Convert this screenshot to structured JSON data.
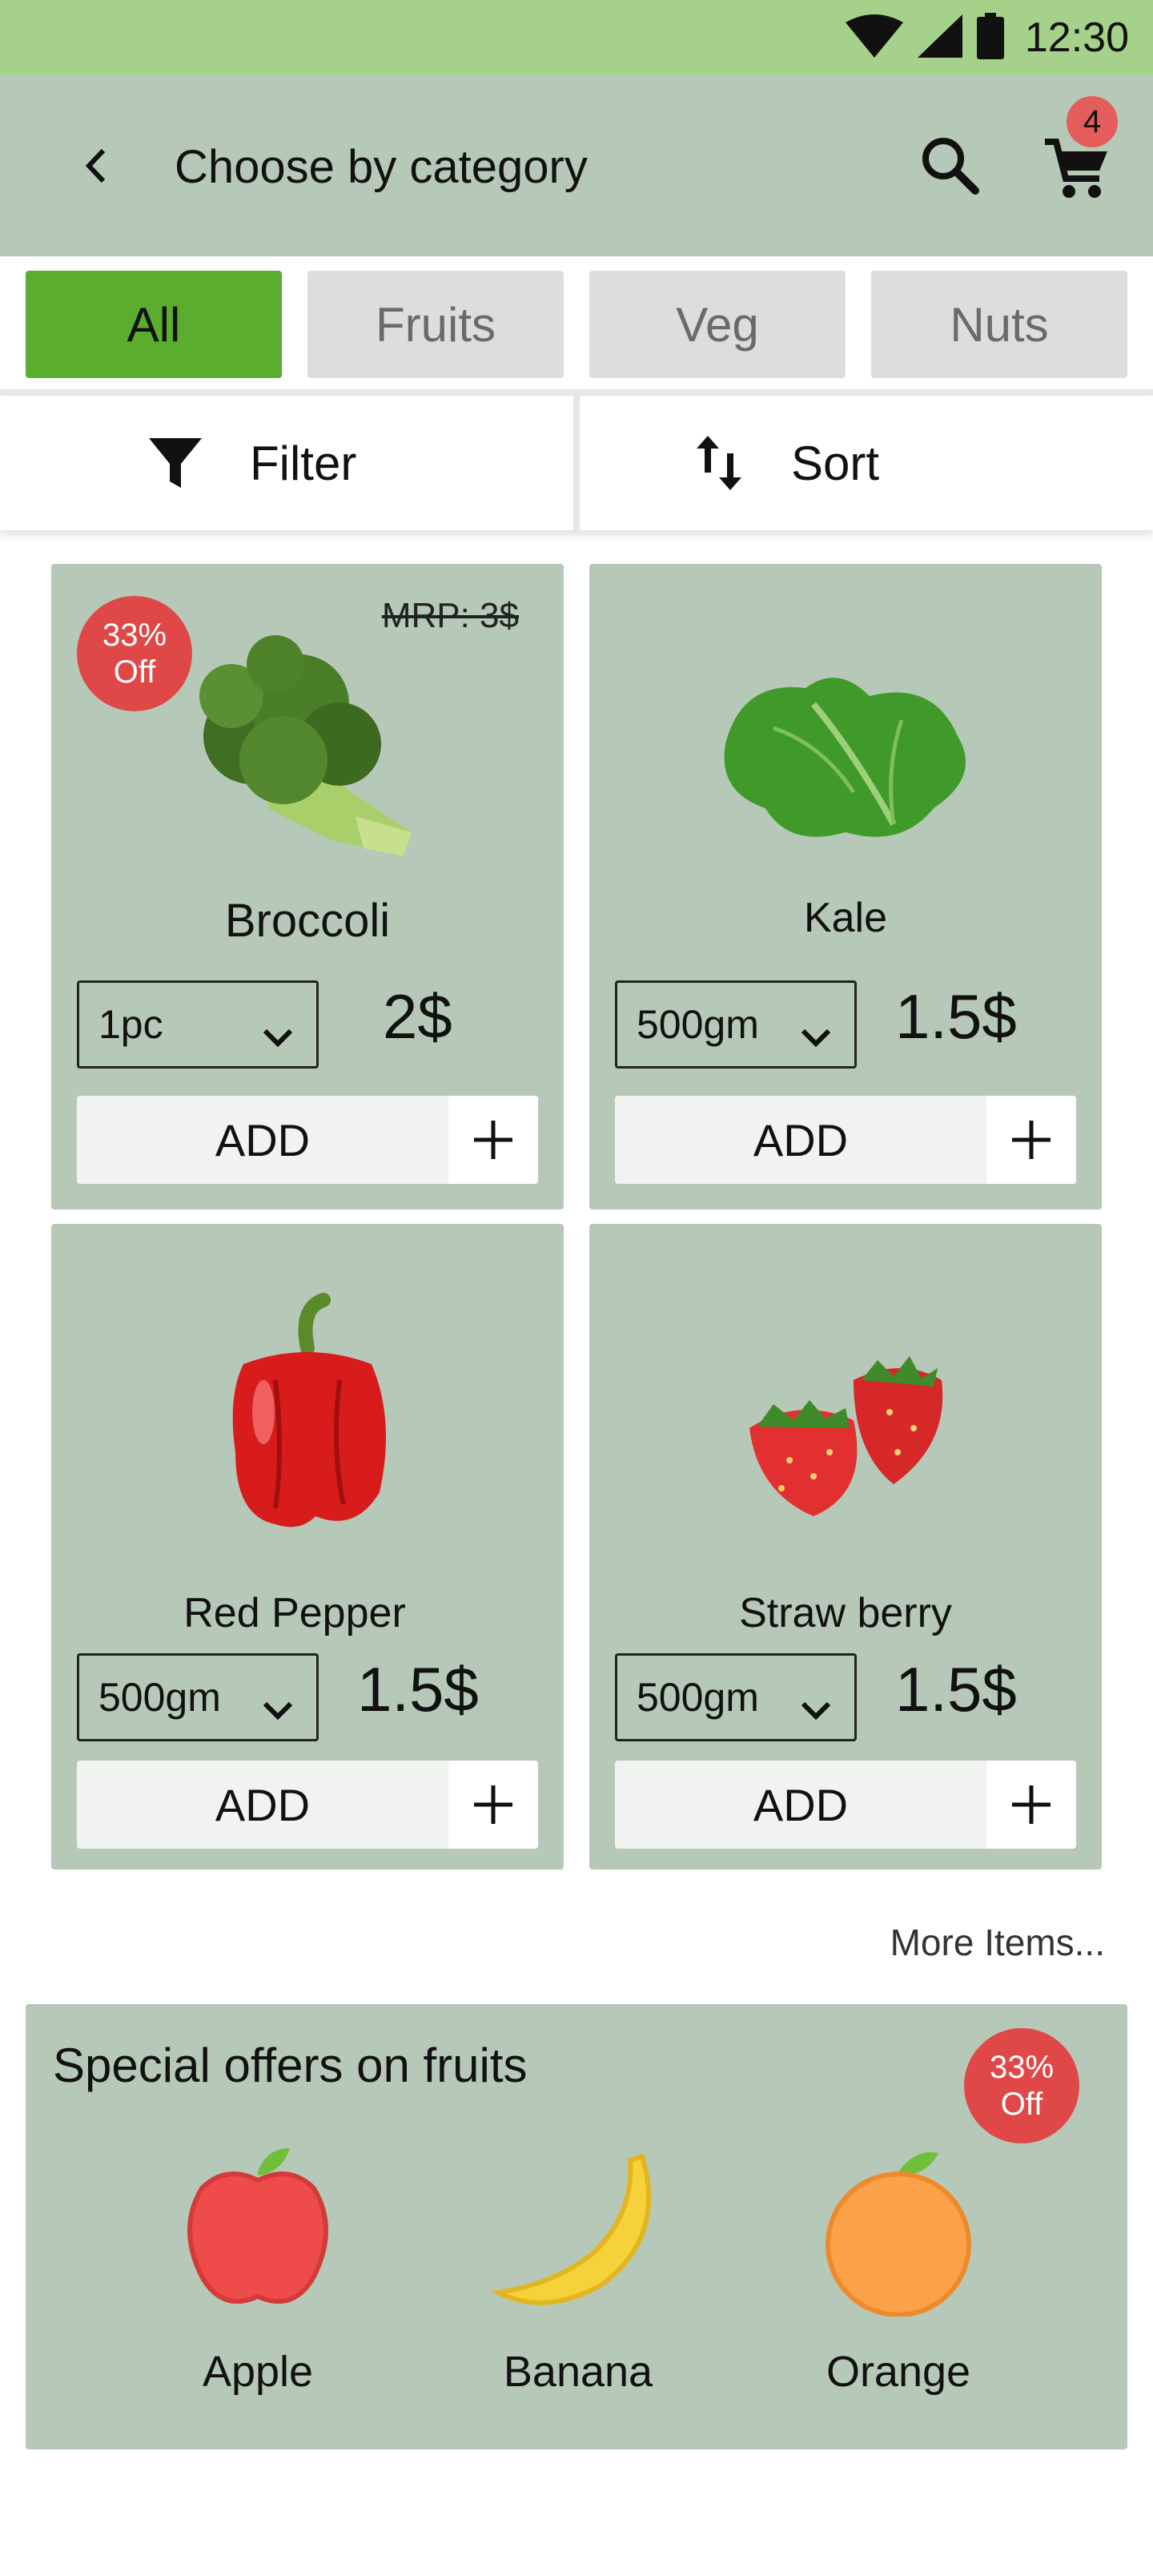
{
  "status_bar": {
    "time": "12:30"
  },
  "header": {
    "title": "Choose by category",
    "cart_count": "4"
  },
  "tabs": [
    {
      "label": "All",
      "active": true
    },
    {
      "label": "Fruits",
      "active": false
    },
    {
      "label": "Veg",
      "active": false
    },
    {
      "label": "Nuts",
      "active": false
    }
  ],
  "toolbar": {
    "filter_label": "Filter",
    "sort_label": "Sort"
  },
  "products": [
    {
      "name": "Broccoli",
      "qty": "1pc",
      "price": "2$",
      "add_label": "ADD",
      "mrp": "MRP: 3$",
      "discount_pct": "33%",
      "discount_word": "Off"
    },
    {
      "name": "Kale",
      "qty": "500gm",
      "price": "1.5$",
      "add_label": "ADD"
    },
    {
      "name": "Red Pepper",
      "qty": "500gm",
      "price": "1.5$",
      "add_label": "ADD"
    },
    {
      "name": "Straw berry",
      "qty": "500gm",
      "price": "1.5$",
      "add_label": "ADD"
    }
  ],
  "more_items": "More Items...",
  "offers": {
    "title": "Special offers on fruits",
    "discount_pct": "33%",
    "discount_word": "Off",
    "fruits": [
      {
        "name": "Apple",
        "icon": "apple-icon"
      },
      {
        "name": "Banana",
        "icon": "banana-icon"
      },
      {
        "name": "Orange",
        "icon": "orange-icon"
      }
    ]
  },
  "colors": {
    "status_bar": "#a5d18a",
    "app_bar": "#b6c8b7",
    "active_tab": "#5aad2e",
    "inactive_tab": "#dddddd",
    "card": "#b6c8b7",
    "discount_badge": "#e04848"
  }
}
